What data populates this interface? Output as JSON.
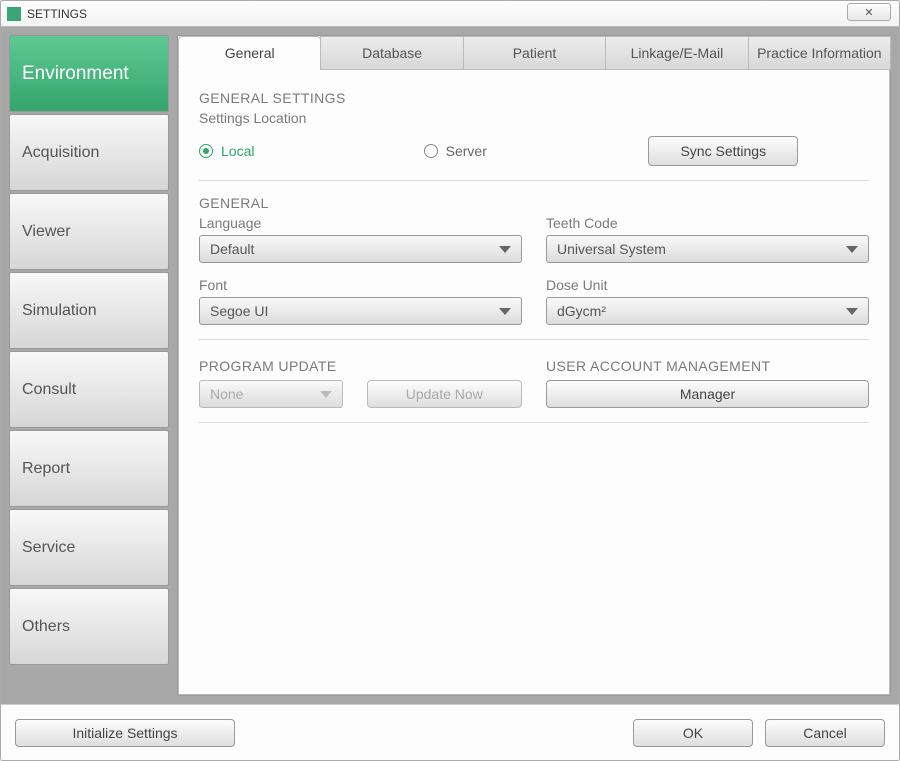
{
  "window": {
    "title": "SETTINGS"
  },
  "sidebar": {
    "items": [
      "Environment",
      "Acquisition",
      "Viewer",
      "Simulation",
      "Consult",
      "Report",
      "Service",
      "Others"
    ]
  },
  "tabs": [
    "General",
    "Database",
    "Patient",
    "Linkage/E-Mail",
    "Practice Information"
  ],
  "generalSettings": {
    "title": "GENERAL SETTINGS",
    "locationLabel": "Settings Location",
    "localLabel": "Local",
    "serverLabel": "Server",
    "syncBtn": "Sync Settings"
  },
  "general": {
    "title": "GENERAL",
    "languageLabel": "Language",
    "languageValue": "Default",
    "teethLabel": "Teeth Code",
    "teethValue": "Universal System",
    "fontLabel": "Font",
    "fontValue": "Segoe UI",
    "doseLabel": "Dose Unit",
    "doseValue": "dGycm²"
  },
  "programUpdate": {
    "title": "PROGRAM UPDATE",
    "modeValue": "None",
    "updateBtn": "Update Now"
  },
  "userMgmt": {
    "title": "USER ACCOUNT MANAGEMENT",
    "managerBtn": "Manager"
  },
  "footer": {
    "init": "Initialize Settings",
    "ok": "OK",
    "cancel": "Cancel"
  }
}
